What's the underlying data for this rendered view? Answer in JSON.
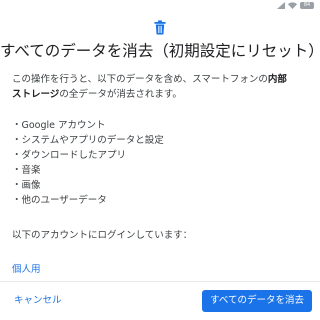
{
  "status_bar": {
    "battery_level": "84",
    "icons": [
      "signal-icon",
      "wifi-icon",
      "battery-icon"
    ]
  },
  "dialog": {
    "header_icon": "trash-icon",
    "title": "すべてのデータを消去（初期設定にリセット）",
    "description": {
      "prefix": "この操作を行うと、以下のデータを含め、スマートフォンの",
      "bold1": "内部",
      "bold2": "ストレージ",
      "suffix": "の全データが消去されます。"
    },
    "items": [
      "・Google アカウント",
      "・システムやアプリのデータと設定",
      "・ダウンロードしたアプリ",
      "・音楽",
      "・画像",
      "・他のユーザーデータ"
    ],
    "account_note": "以下のアカウントにログインしています：",
    "account_name": "個人用"
  },
  "actions": {
    "cancel_label": "キャンセル",
    "erase_label": "すべてのデータを消去"
  },
  "colors": {
    "accent": "#1a73e8",
    "text_primary": "#202124",
    "text_secondary": "#3c4043",
    "background": "#ffffff"
  }
}
